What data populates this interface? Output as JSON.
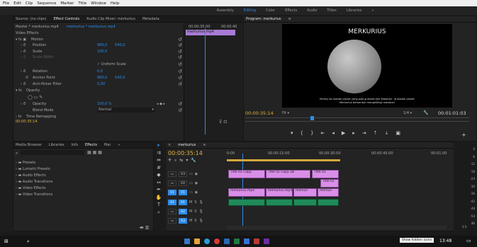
{
  "menu": [
    "File",
    "Edit",
    "Clip",
    "Sequence",
    "Marker",
    "Title",
    "Window",
    "Help"
  ],
  "workspaces": {
    "items": [
      "Assembly",
      "Editing",
      "Color",
      "Effects",
      "Audio",
      "Titles",
      "Libraries"
    ],
    "active": "Editing",
    "more": "»"
  },
  "ec": {
    "tabs": [
      "Source: (no clips)",
      "Effect Controls",
      "Audio Clip Mixer: merkurius",
      "Metadata"
    ],
    "master": "Master * merkurius.mp4",
    "seq": "merkurius * merkurius.mp4",
    "ruler_a": "00:00:35:00",
    "ruler_b": "00:00:40",
    "clip_name": "merkurius.mp4",
    "video_effects": "Video Effects",
    "motion": "Motion",
    "position_l": "Position",
    "pos_x": "960,0",
    "pos_y": "540,0",
    "scale_l": "Scale",
    "scale_v": "100,0",
    "scale_w_l": "Scale Width",
    "uniform": "Uniform Scale",
    "rotation_l": "Rotation",
    "rotation_v": "0,0",
    "anchor_l": "Anchor Point",
    "anchor_x": "960,0",
    "anchor_y": "540,0",
    "flicker_l": "Anti-flicker Filter",
    "flicker_v": "0,00",
    "opacity": "Opacity",
    "opacity_l": "Opacity",
    "opacity_v": "100,0 %",
    "blend_l": "Blend Mode",
    "blend_v": "Normal",
    "time_remap": "Time Remapping",
    "tc": "00:00:35:14"
  },
  "program": {
    "tab": "Program: merkurius",
    "title": "MERKURIUS",
    "caption1": "Merkurius adalah planet yang paling dekat dari Matahari. Ia adalah planet",
    "caption2": "Merkurius berbentuk mengelilingi matahari",
    "tc": "00:00:35:14",
    "fit": "Fit",
    "zoom": "1/4",
    "dur": "00:01:01:03"
  },
  "project": {
    "tabs": [
      "Media Browser",
      "Libraries",
      "Info",
      "Effects",
      "Mar"
    ],
    "search_ph": "",
    "items": [
      "Presets",
      "Lumetri Presets",
      "Audio Effects",
      "Audio Transitions",
      "Video Effects",
      "Video Transitions"
    ]
  },
  "timeline": {
    "tab": "merkurius",
    "tc": "00:00:35:14",
    "ruler": [
      "0:00",
      "00:00:15:00",
      "00:00:30:00",
      "00:00:45:00",
      "00:01:00"
    ],
    "tracks_v": [
      "V3",
      "V2",
      "V1"
    ],
    "tracks_a": [
      "A1",
      "A2",
      "A3"
    ],
    "v3": [
      "Title 01 Copy",
      "Title 01 Copy 2B",
      "Title 01"
    ],
    "v2": [
      "Title 01"
    ],
    "v1": [
      "merkurius.mp4",
      "merkurius.mp4",
      "merkuri",
      "merkuri"
    ]
  },
  "meter": {
    "labels": [
      "0",
      "-6",
      "-12",
      "-18",
      "-24",
      "-30",
      "-36",
      "-42",
      "-48",
      "-54",
      "dB"
    ],
    "s": "S S"
  },
  "taskbar": {
    "tooltip": "Show hidden icons",
    "time": "13:48"
  }
}
